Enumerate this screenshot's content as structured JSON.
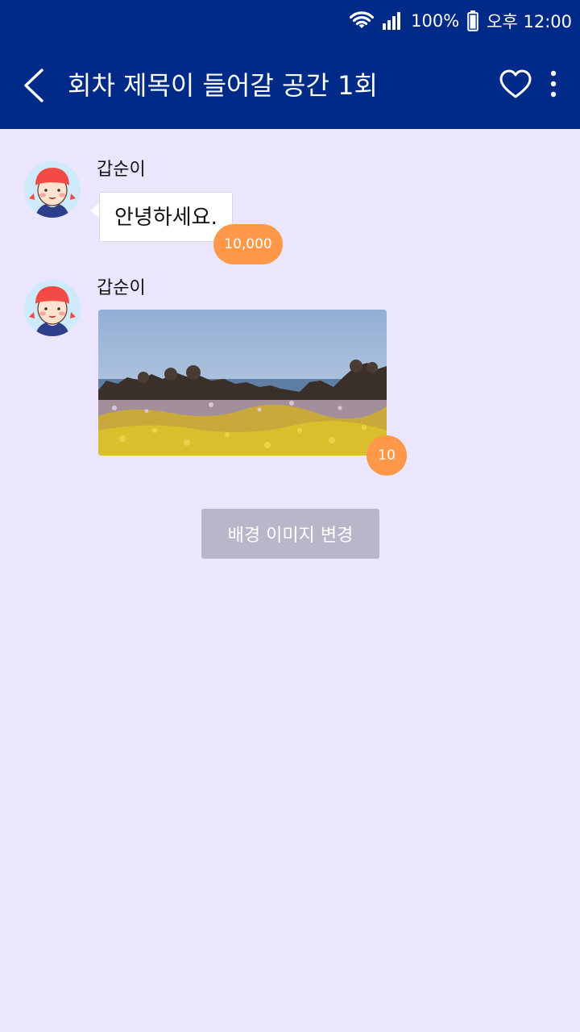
{
  "status_bar": {
    "battery": "100%",
    "time": "오후 12:00"
  },
  "header": {
    "title": "회차 제목이 들어갈 공간 1회"
  },
  "messages": [
    {
      "sender": "갑순이",
      "text": "안녕하세요.",
      "badge": "10,000"
    },
    {
      "sender": "갑순이",
      "badge": "10"
    }
  ],
  "actions": {
    "change_background_label": "배경 이미지 변경"
  },
  "colors": {
    "header_bg": "#002a87",
    "chat_bg": "#ebe6fe",
    "badge": "#ff9848",
    "button_disabled": "#b9b6ca"
  },
  "icons": {
    "back": "chevron-left-icon",
    "favorite": "heart-outline-icon",
    "menu": "more-vertical-icon",
    "wifi": "wifi-icon",
    "signal": "signal-icon",
    "battery": "battery-icon"
  }
}
